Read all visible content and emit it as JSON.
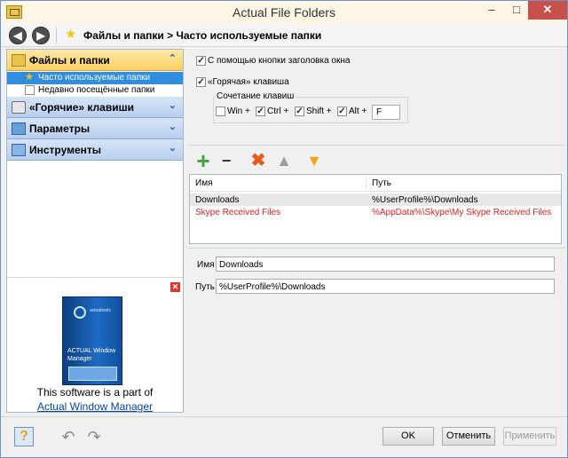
{
  "window": {
    "title": "Actual File Folders",
    "min": "–",
    "max": "□",
    "close": "✕"
  },
  "nav": {
    "back": "◀",
    "forward": "▶",
    "star": "★",
    "breadcrumb": "Файлы и папки > Часто используемые папки"
  },
  "sidebar": {
    "sections": [
      {
        "label": "Файлы и папки",
        "icon": "folder-icon",
        "expanded": true,
        "chevron": "⌃"
      },
      {
        "label": "«Горячие» клавиши",
        "icon": "keyboard-icon",
        "expanded": false,
        "chevron": "⌄"
      },
      {
        "label": "Параметры",
        "icon": "params-icon",
        "expanded": false,
        "chevron": "⌄"
      },
      {
        "label": "Инструменты",
        "icon": "tools-icon",
        "expanded": false,
        "chevron": "⌄"
      }
    ],
    "sub_items": [
      {
        "label": "Часто используемые папки",
        "icon": "star-icon",
        "glyph": "★",
        "selected": true
      },
      {
        "label": "Недавно посещённые папки",
        "icon": "document-icon",
        "glyph": "",
        "selected": false
      }
    ],
    "promo": {
      "close": "✕",
      "box_brand": "actualtools",
      "box_name": "ACTUAL Window Manager",
      "text": "This software is a part of",
      "link": "Actual Window Manager"
    }
  },
  "settings": {
    "title_button": {
      "label": "С помощью кнопки заголовка окна",
      "checked": true,
      "mark": "✓"
    },
    "hotkey": {
      "label": "«Горячая» клавиша",
      "checked": true,
      "mark": "✓"
    },
    "hotkey_group": {
      "legend": "Сочетание клавиш",
      "win": {
        "label": "Win +",
        "checked": false
      },
      "ctrl": {
        "label": "Ctrl +",
        "checked": true
      },
      "shift": {
        "label": "Shift +",
        "checked": true
      },
      "alt": {
        "label": "Alt +",
        "checked": true
      },
      "key": "F"
    }
  },
  "toolbar": {
    "add": "+",
    "remove": "− −",
    "delete": "✖",
    "up": "▲",
    "down": "▼"
  },
  "table": {
    "columns": [
      "Имя",
      "Путь"
    ],
    "rows": [
      {
        "name": "Downloads",
        "path": "%UserProfile%\\Downloads",
        "color": "#000000",
        "selected": true
      },
      {
        "name": "Skype Received Files",
        "path": "%AppData%\\Skype\\My Skype Received Files",
        "color": "#e02020",
        "selected": false
      }
    ]
  },
  "detail": {
    "name_label": "Имя",
    "name_value": "Downloads",
    "path_label": "Путь",
    "path_value": "%UserProfile%\\Downloads"
  },
  "footer": {
    "help": "?",
    "undo": "↶",
    "redo": "↷",
    "ok": "OK",
    "cancel": "Отменить",
    "apply": "Применить"
  }
}
